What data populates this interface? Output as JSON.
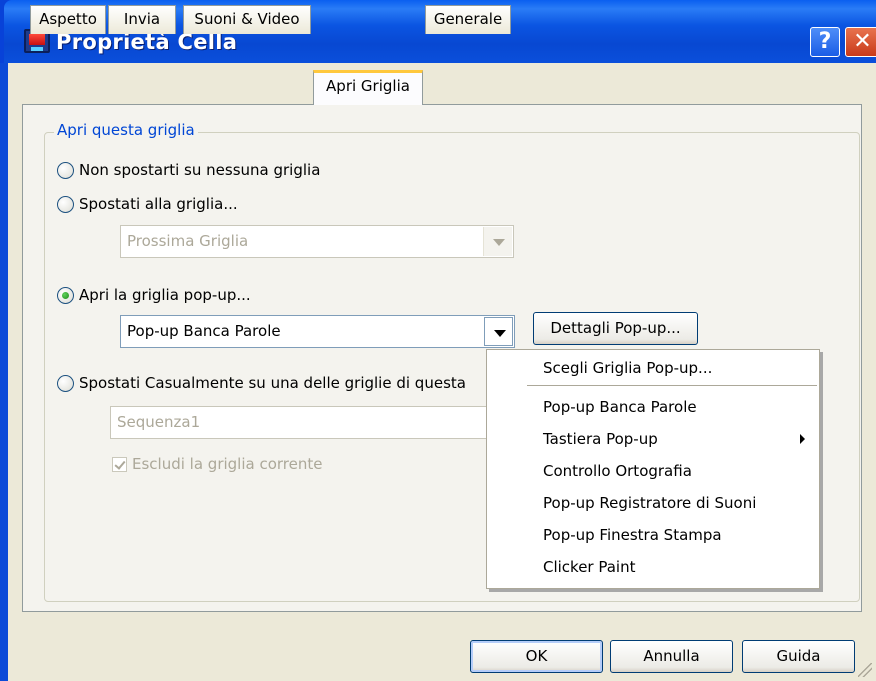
{
  "window": {
    "title": "Proprietà Cella",
    "help_label": "?",
    "close_label": "✕"
  },
  "tabs": [
    {
      "label": "Aspetto"
    },
    {
      "label": "Invia"
    },
    {
      "label": "Suoni & Video"
    },
    {
      "label": "Apri Griglia",
      "active": true
    },
    {
      "label": "Generale"
    }
  ],
  "group": {
    "label": "Apri questa griglia",
    "options": [
      {
        "label": "Non spostarti su nessuna griglia",
        "checked": false
      },
      {
        "label": "Spostati alla griglia...",
        "checked": false
      },
      {
        "label": "Apri la griglia pop-up...",
        "checked": true
      },
      {
        "label": "Spostati Casualmente su una delle griglie di questa",
        "checked": false
      }
    ],
    "next_grid_combo": {
      "value": "Prossima Griglia",
      "disabled": true
    },
    "popup_combo": {
      "value": "Pop-up Banca Parole"
    },
    "details_button": "Dettagli Pop-up...",
    "sequence_combo": {
      "value": "Sequenza1",
      "disabled": true
    },
    "exclude_checkbox": {
      "label": "Escludi la griglia corrente",
      "checked": true,
      "disabled": true
    }
  },
  "dropdown_menu": {
    "items": [
      {
        "label": "Scegli Griglia Pop-up..."
      },
      {
        "label": "Pop-up Banca Parole"
      },
      {
        "label": "Tastiera Pop-up",
        "submenu": true
      },
      {
        "label": "Controllo Ortografia"
      },
      {
        "label": "Pop-up Registratore di Suoni"
      },
      {
        "label": "Pop-up Finestra Stampa"
      },
      {
        "label": "Clicker Paint"
      }
    ]
  },
  "footer": {
    "ok_label": "OK",
    "cancel_label": "Annulla",
    "help_label": "Guida"
  },
  "colors": {
    "titlebar": "#0a4fdb",
    "group_label": "#0046d5",
    "active_tab_highlight": "#ffc83c",
    "dialog_bg": "#ece9d8"
  }
}
